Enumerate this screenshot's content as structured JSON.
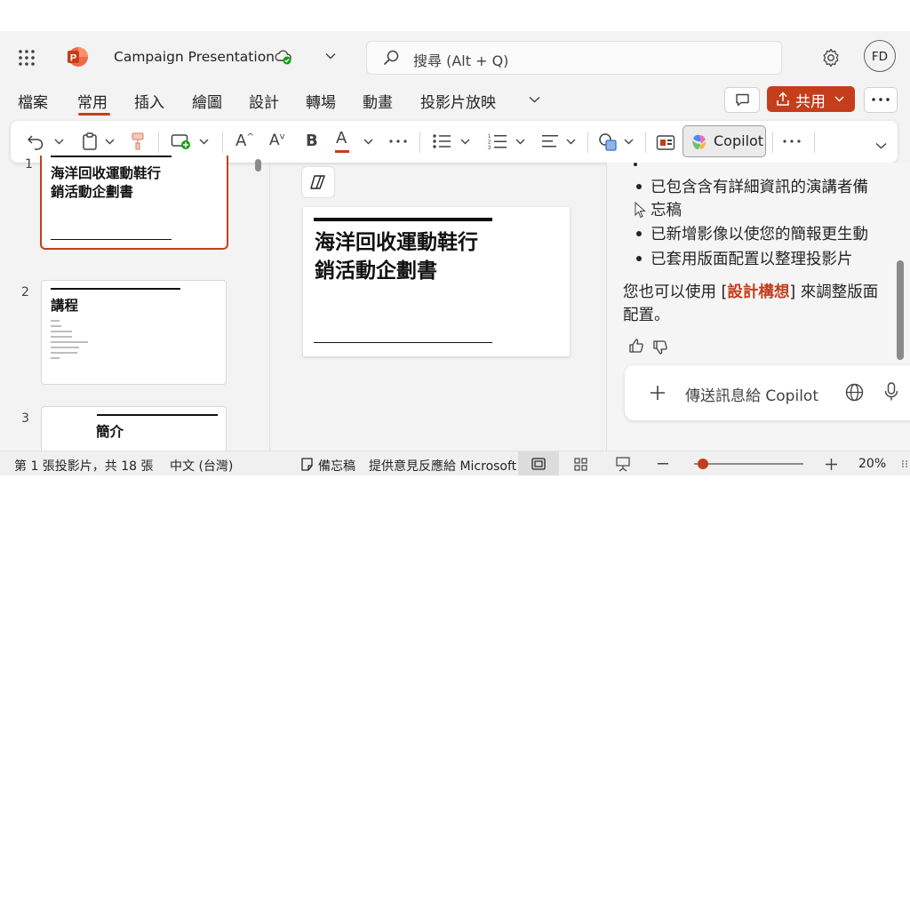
{
  "app": {
    "title": "Campaign Presentation",
    "search_placeholder": "搜尋 (Alt + Q)",
    "avatar_initials": "FD",
    "brand_color": "#c43e1c"
  },
  "menu": {
    "tabs": [
      "檔案",
      "常用",
      "插入",
      "繪圖",
      "設計",
      "轉場",
      "動畫",
      "投影片放映"
    ],
    "active_tab": "常用",
    "share_label": "共用"
  },
  "ribbon": {
    "font_grow": "A",
    "font_shrink": "A",
    "bold": "B",
    "font_color": "A",
    "copilot_label": "Copilot"
  },
  "slides": {
    "thumb1": {
      "number": "1",
      "title_line1": "海洋回收運動鞋行",
      "title_line2": "銷活動企劃書"
    },
    "thumb2": {
      "number": "2",
      "title": "講程"
    },
    "thumb3": {
      "number": "3",
      "title": "簡介"
    }
  },
  "editor": {
    "slide_title_line1": "海洋回收運動鞋行",
    "slide_title_line2": "銷活動企劃書"
  },
  "copilot": {
    "bullets": [
      "已包含含有詳細資訊的演講者備",
      "忘稿",
      "已新增影像以使您的簡報更生動",
      "已套用版面配置以整理投影片"
    ],
    "tip_prefix": "您也可以使用 [",
    "tip_link": "設計構想",
    "tip_suffix": "] 來調整版面",
    "tip_line2": "配置。",
    "input_placeholder": "傳送訊息給 Copilot"
  },
  "status": {
    "slide_count": "第 1 張投影片，共 18 張",
    "language": "中文 (台灣)",
    "notes_label": "備忘稿",
    "feedback_label": "提供意見反應給 Microsoft",
    "zoom_percent": "20%",
    "zoom_level": 0.08
  }
}
